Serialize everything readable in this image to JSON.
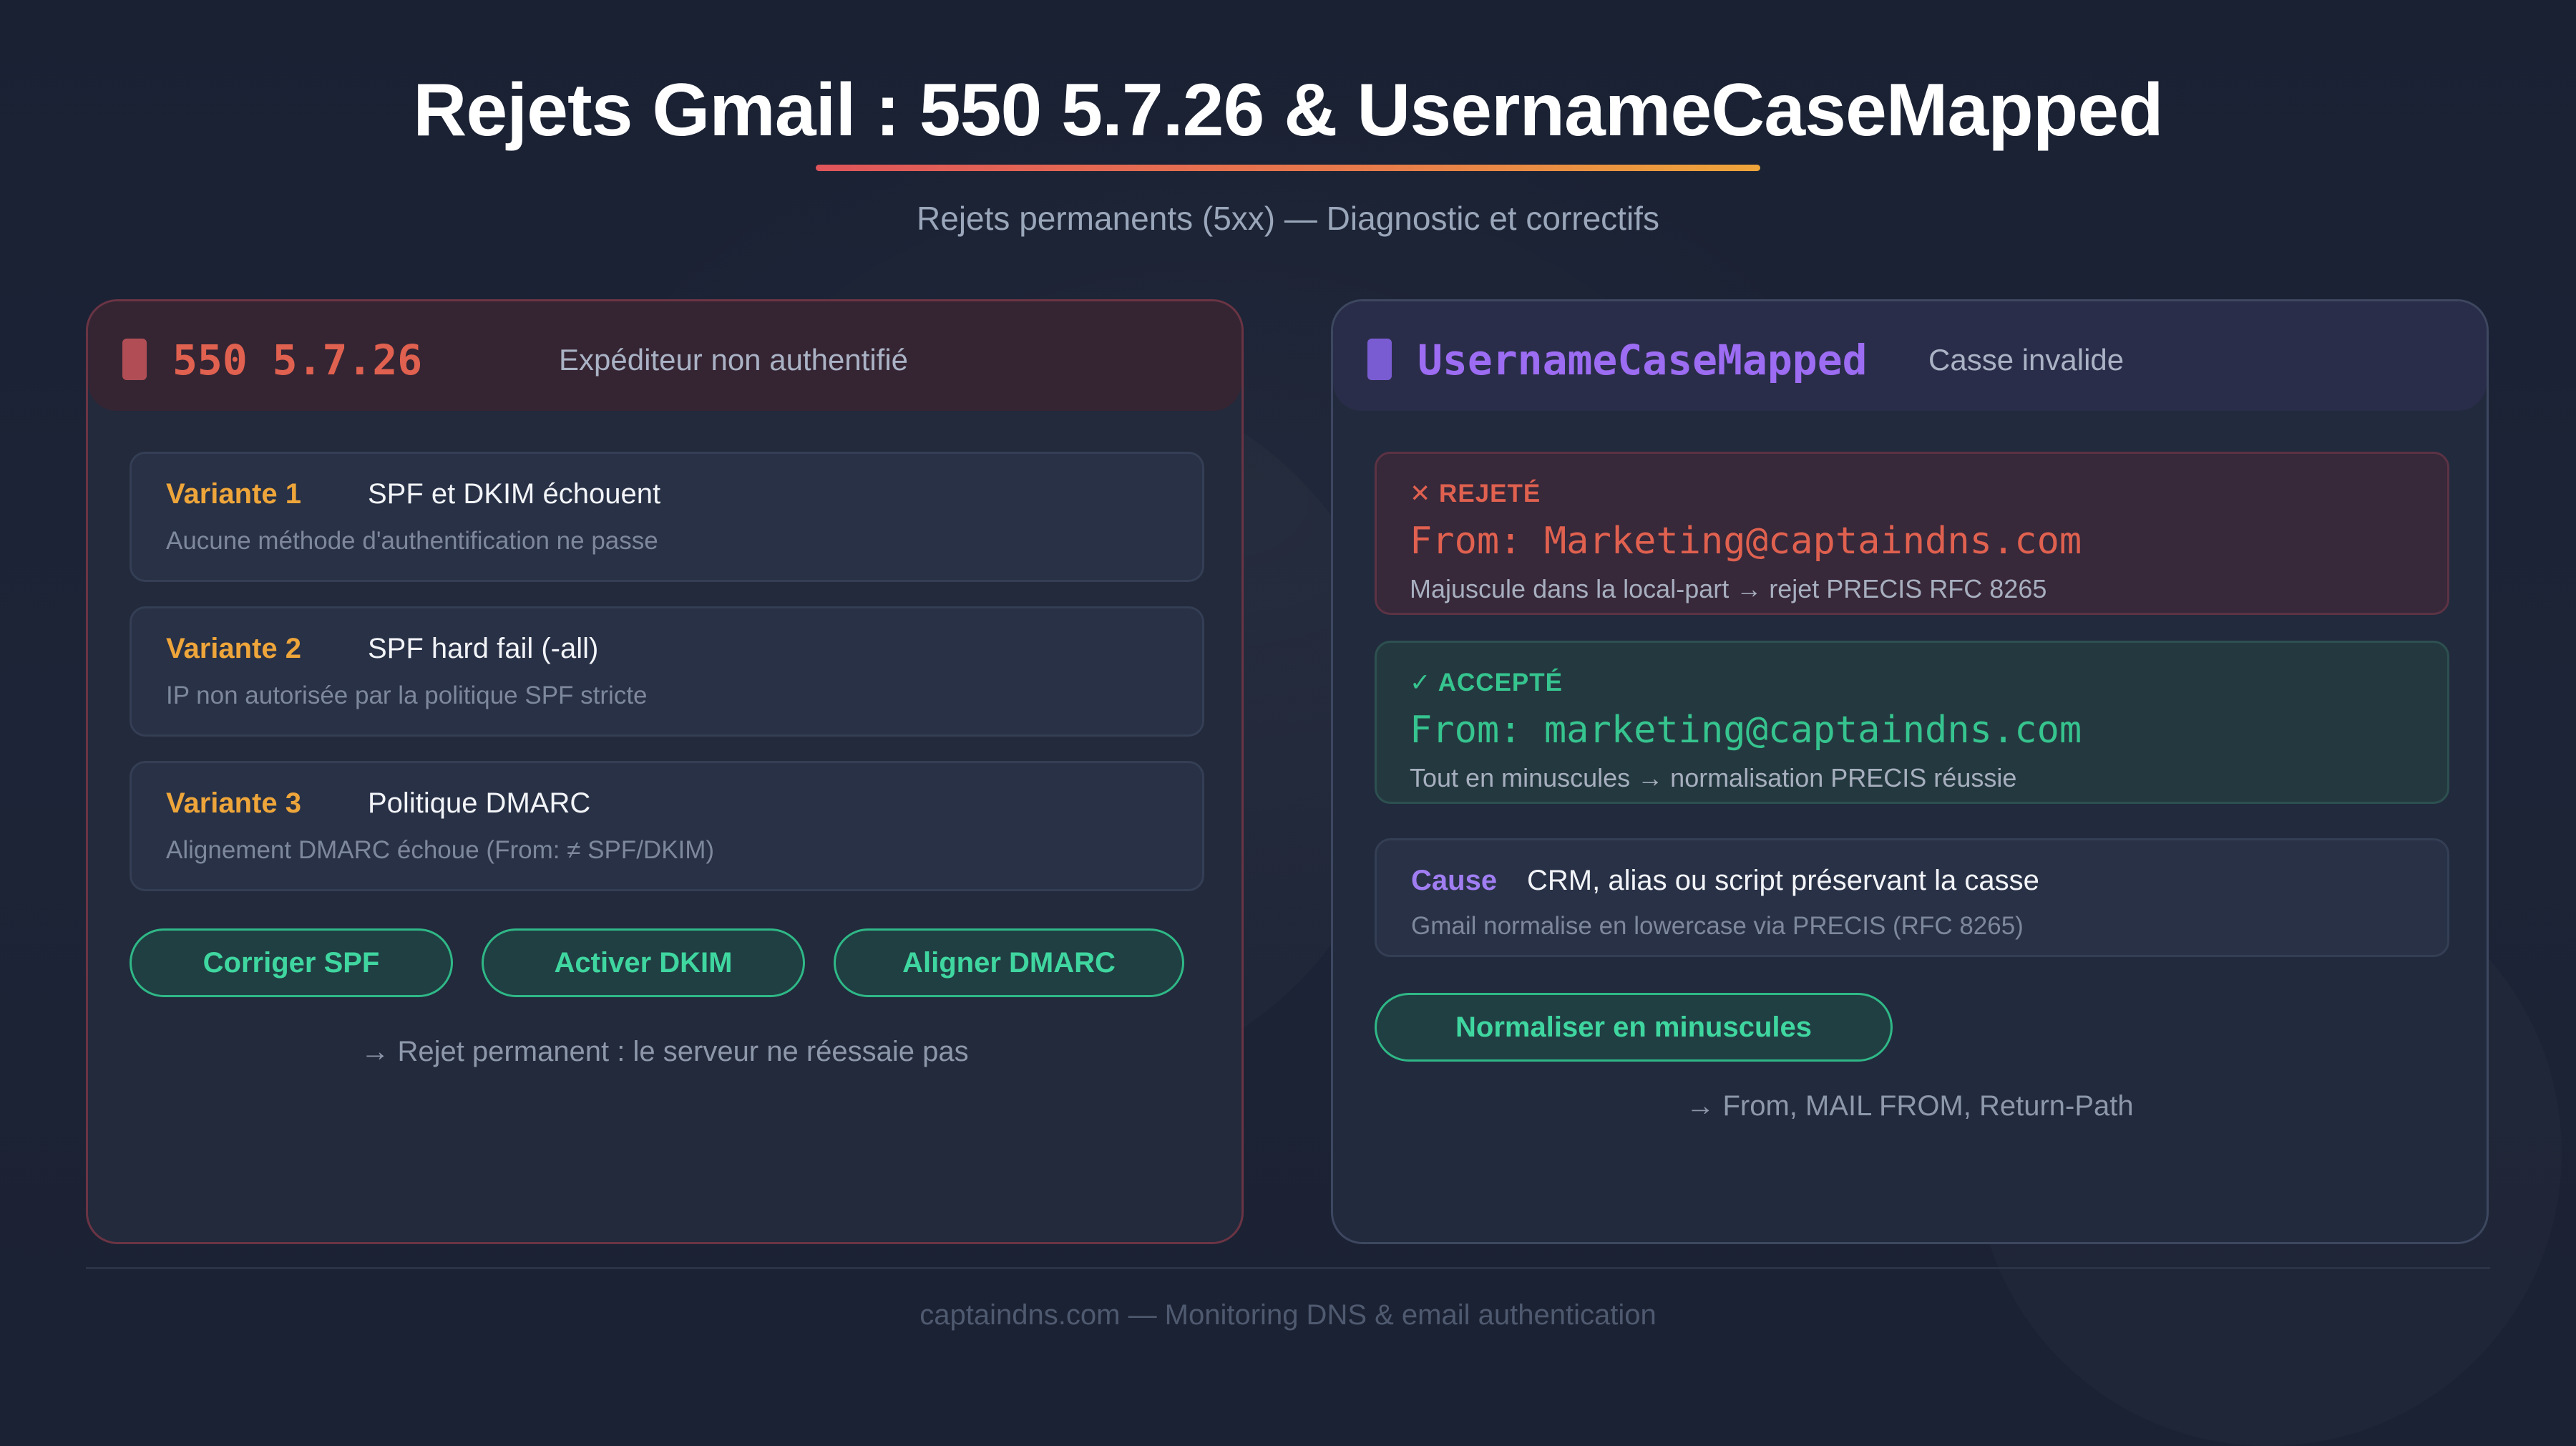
{
  "header": {
    "title": "Rejets Gmail : 550 5.7.26 & UsernameCaseMapped",
    "subtitle": "Rejets permanents (5xx) — Diagnostic et correctifs"
  },
  "left_card": {
    "code": "550 5.7.26",
    "description": "Expéditeur non authentifié",
    "variants": [
      {
        "label": "Variante 1",
        "title": "SPF et DKIM échouent",
        "desc": "Aucune méthode d'authentification ne passe"
      },
      {
        "label": "Variante 2",
        "title": "SPF hard fail (-all)",
        "desc": "IP non autorisée par la politique SPF stricte"
      },
      {
        "label": "Variante 3",
        "title": "Politique DMARC",
        "desc": "Alignement DMARC échoue (From: ≠ SPF/DKIM)"
      }
    ],
    "actions": [
      "Corriger SPF",
      "Activer DKIM",
      "Aligner DMARC"
    ],
    "footnote": "→ Rejet permanent : le serveur ne réessaie pas"
  },
  "right_card": {
    "code": "UsernameCaseMapped",
    "description": "Casse invalide",
    "rejected": {
      "label": "✕ REJETÉ",
      "from": "From: Marketing@captaindns.com",
      "desc": "Majuscule dans la local-part → rejet PRECIS RFC 8265"
    },
    "accepted": {
      "label": "✓ ACCEPTÉ",
      "from": "From: marketing@captaindns.com",
      "desc": "Tout en minuscules → normalisation PRECIS réussie"
    },
    "cause": {
      "label": "Cause",
      "title": "CRM, alias ou script préservant la casse",
      "desc": "Gmail normalise en lowercase via PRECIS (RFC 8265)"
    },
    "action": "Normaliser en minuscules",
    "footnote": "→ From, MAIL FROM, Return-Path"
  },
  "footer": {
    "text": "captaindns.com — Monitoring DNS & email authentication"
  },
  "colors": {
    "background": "#1b2234",
    "left_accent": "#e0614f",
    "right_accent": "#9c6cf2",
    "variant_label": "#eea53a",
    "action_green": "#3fd6a0",
    "accepted_green": "#36c48f"
  }
}
